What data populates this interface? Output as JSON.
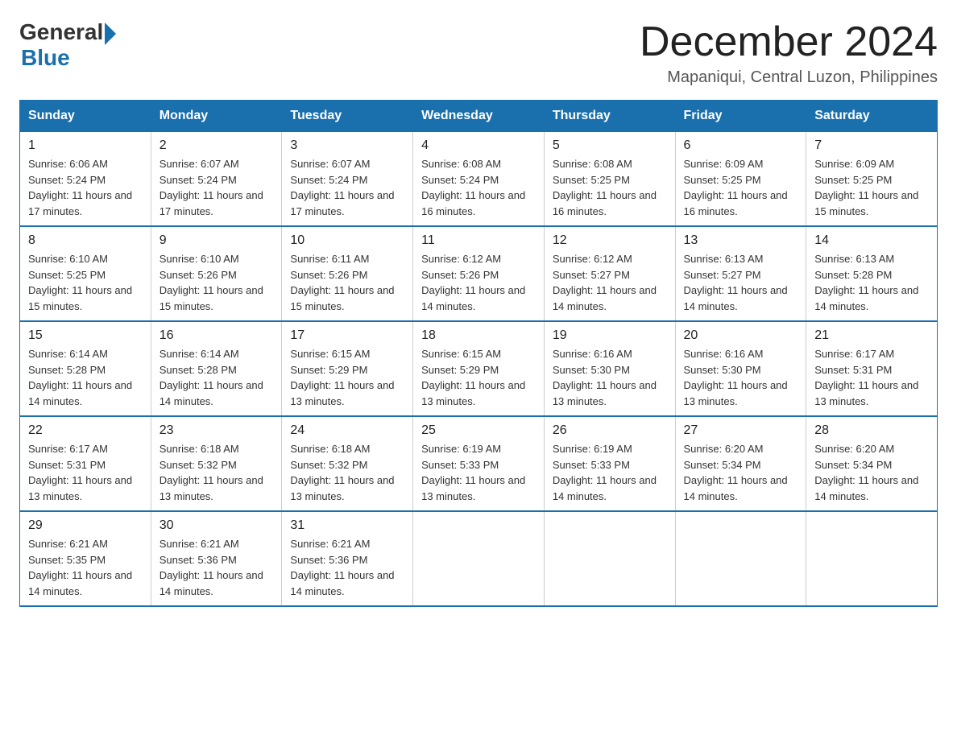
{
  "header": {
    "logo_general": "General",
    "logo_blue": "Blue",
    "month_title": "December 2024",
    "location": "Mapaniqui, Central Luzon, Philippines"
  },
  "weekdays": [
    "Sunday",
    "Monday",
    "Tuesday",
    "Wednesday",
    "Thursday",
    "Friday",
    "Saturday"
  ],
  "weeks": [
    [
      {
        "day": "1",
        "sunrise": "6:06 AM",
        "sunset": "5:24 PM",
        "daylight": "11 hours and 17 minutes."
      },
      {
        "day": "2",
        "sunrise": "6:07 AM",
        "sunset": "5:24 PM",
        "daylight": "11 hours and 17 minutes."
      },
      {
        "day": "3",
        "sunrise": "6:07 AM",
        "sunset": "5:24 PM",
        "daylight": "11 hours and 17 minutes."
      },
      {
        "day": "4",
        "sunrise": "6:08 AM",
        "sunset": "5:24 PM",
        "daylight": "11 hours and 16 minutes."
      },
      {
        "day": "5",
        "sunrise": "6:08 AM",
        "sunset": "5:25 PM",
        "daylight": "11 hours and 16 minutes."
      },
      {
        "day": "6",
        "sunrise": "6:09 AM",
        "sunset": "5:25 PM",
        "daylight": "11 hours and 16 minutes."
      },
      {
        "day": "7",
        "sunrise": "6:09 AM",
        "sunset": "5:25 PM",
        "daylight": "11 hours and 15 minutes."
      }
    ],
    [
      {
        "day": "8",
        "sunrise": "6:10 AM",
        "sunset": "5:25 PM",
        "daylight": "11 hours and 15 minutes."
      },
      {
        "day": "9",
        "sunrise": "6:10 AM",
        "sunset": "5:26 PM",
        "daylight": "11 hours and 15 minutes."
      },
      {
        "day": "10",
        "sunrise": "6:11 AM",
        "sunset": "5:26 PM",
        "daylight": "11 hours and 15 minutes."
      },
      {
        "day": "11",
        "sunrise": "6:12 AM",
        "sunset": "5:26 PM",
        "daylight": "11 hours and 14 minutes."
      },
      {
        "day": "12",
        "sunrise": "6:12 AM",
        "sunset": "5:27 PM",
        "daylight": "11 hours and 14 minutes."
      },
      {
        "day": "13",
        "sunrise": "6:13 AM",
        "sunset": "5:27 PM",
        "daylight": "11 hours and 14 minutes."
      },
      {
        "day": "14",
        "sunrise": "6:13 AM",
        "sunset": "5:28 PM",
        "daylight": "11 hours and 14 minutes."
      }
    ],
    [
      {
        "day": "15",
        "sunrise": "6:14 AM",
        "sunset": "5:28 PM",
        "daylight": "11 hours and 14 minutes."
      },
      {
        "day": "16",
        "sunrise": "6:14 AM",
        "sunset": "5:28 PM",
        "daylight": "11 hours and 14 minutes."
      },
      {
        "day": "17",
        "sunrise": "6:15 AM",
        "sunset": "5:29 PM",
        "daylight": "11 hours and 13 minutes."
      },
      {
        "day": "18",
        "sunrise": "6:15 AM",
        "sunset": "5:29 PM",
        "daylight": "11 hours and 13 minutes."
      },
      {
        "day": "19",
        "sunrise": "6:16 AM",
        "sunset": "5:30 PM",
        "daylight": "11 hours and 13 minutes."
      },
      {
        "day": "20",
        "sunrise": "6:16 AM",
        "sunset": "5:30 PM",
        "daylight": "11 hours and 13 minutes."
      },
      {
        "day": "21",
        "sunrise": "6:17 AM",
        "sunset": "5:31 PM",
        "daylight": "11 hours and 13 minutes."
      }
    ],
    [
      {
        "day": "22",
        "sunrise": "6:17 AM",
        "sunset": "5:31 PM",
        "daylight": "11 hours and 13 minutes."
      },
      {
        "day": "23",
        "sunrise": "6:18 AM",
        "sunset": "5:32 PM",
        "daylight": "11 hours and 13 minutes."
      },
      {
        "day": "24",
        "sunrise": "6:18 AM",
        "sunset": "5:32 PM",
        "daylight": "11 hours and 13 minutes."
      },
      {
        "day": "25",
        "sunrise": "6:19 AM",
        "sunset": "5:33 PM",
        "daylight": "11 hours and 13 minutes."
      },
      {
        "day": "26",
        "sunrise": "6:19 AM",
        "sunset": "5:33 PM",
        "daylight": "11 hours and 14 minutes."
      },
      {
        "day": "27",
        "sunrise": "6:20 AM",
        "sunset": "5:34 PM",
        "daylight": "11 hours and 14 minutes."
      },
      {
        "day": "28",
        "sunrise": "6:20 AM",
        "sunset": "5:34 PM",
        "daylight": "11 hours and 14 minutes."
      }
    ],
    [
      {
        "day": "29",
        "sunrise": "6:21 AM",
        "sunset": "5:35 PM",
        "daylight": "11 hours and 14 minutes."
      },
      {
        "day": "30",
        "sunrise": "6:21 AM",
        "sunset": "5:36 PM",
        "daylight": "11 hours and 14 minutes."
      },
      {
        "day": "31",
        "sunrise": "6:21 AM",
        "sunset": "5:36 PM",
        "daylight": "11 hours and 14 minutes."
      },
      null,
      null,
      null,
      null
    ]
  ]
}
